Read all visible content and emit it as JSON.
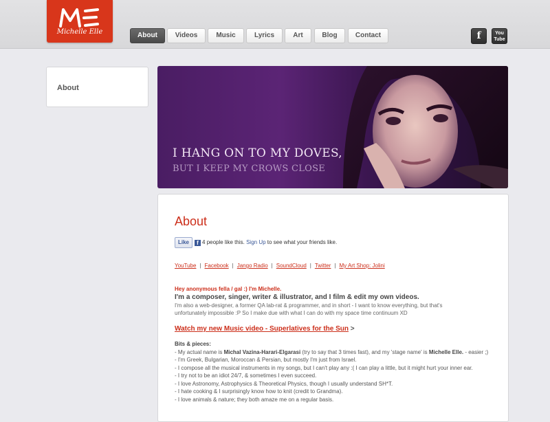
{
  "brand": {
    "logo_text": "Michelle Elle",
    "accent": "#d8361b"
  },
  "nav": {
    "tabs": [
      "About",
      "Videos",
      "Music",
      "Lyrics",
      "Art",
      "Blog",
      "Contact"
    ],
    "active": "About"
  },
  "social": {
    "facebook_glyph": "f",
    "youtube_label": "You Tube"
  },
  "sidebar": {
    "items": [
      {
        "label": "About"
      }
    ]
  },
  "banner": {
    "line1": "I HANG ON TO MY DOVES,",
    "line2": "BUT I KEEP MY CROWS CLOSE"
  },
  "content": {
    "title": "About",
    "like": {
      "button": "Like",
      "count_text": "4 people like this.",
      "signup": "Sign Up",
      "suffix": "to see what your friends like."
    },
    "links": [
      "YouTube",
      "Facebook",
      "Jango Radio",
      "SoundCloud",
      "Twitter",
      "My Art Shop: Jolini"
    ],
    "greeting": "Hey anonymous fella / gal :) I'm Michelle.",
    "lead": "I'm a composer, singer, writer & illustrator, and I film & edit my own videos.",
    "para_line1": "I'm also a web-designer, a former QA lab-rat & programmer, and in short - I want to know everything, but that's",
    "para_line2": "unfortunately impossible :P So I make due with what I can do with my space time continuum XD",
    "watch_link": "Watch my new Music video - Superlatives for the Sun",
    "watch_arrow": ">",
    "bits_title": "Bits & pieces:",
    "bits": {
      "b1_pre": "- My actual name is ",
      "b1_name": "Michal Vazina-Harari-Elgarasi",
      "b1_mid": " (try to say that 3 times fast), and my 'stage name' is ",
      "b1_stage": "Michelle Elle.",
      "b1_end": " - easier ;)",
      "b2": "- I'm Greek, Bulgarian, Moroccan & Persian, but mostly I'm just from Israel.",
      "b3": "- I compose all the musical instruments in my songs, but I can't play any :( I can play a little, but it might hurt your inner ear.",
      "b4": "- I try not to be an idiot 24/7, & sometimes I even succeed.",
      "b5": "- I love Astronomy, Astrophysics & Theoretical Physics, though I usually understand SH*T.",
      "b6": "- I hate cooking & I surprisingly know how to knit (credit to Grandma).",
      "b7": "- I love animals & nature; they both amaze me on a regular basis."
    }
  }
}
